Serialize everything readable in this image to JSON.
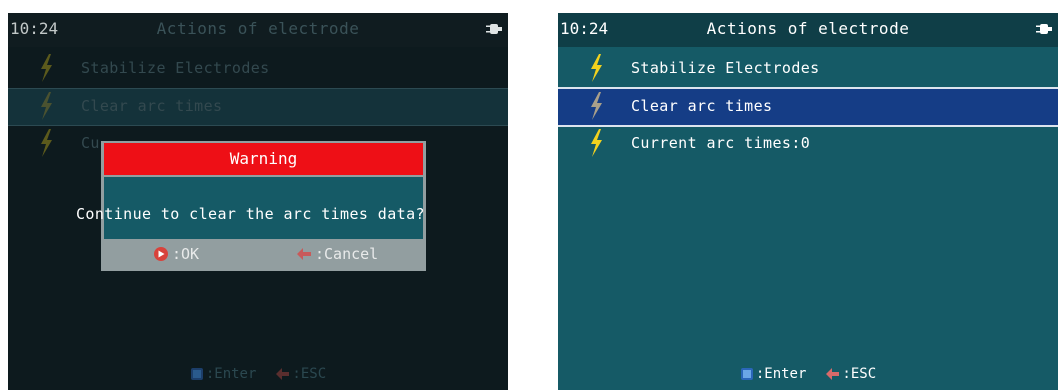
{
  "left": {
    "status": {
      "time": "10:24",
      "title": "Actions of electrode"
    },
    "menu": [
      {
        "label": "Stabilize Electrodes"
      },
      {
        "label": "Clear arc times",
        "selected": true
      },
      {
        "label": "Cu"
      }
    ],
    "dialog": {
      "title": "Warning",
      "message": "Continue to clear the arc times data?",
      "ok_label": ":OK",
      "cancel_label": ":Cancel"
    },
    "footer": {
      "enter": ":Enter",
      "esc": ":ESC"
    }
  },
  "right": {
    "status": {
      "time": "10:24",
      "title": "Actions of electrode"
    },
    "menu": [
      {
        "label": "Stabilize Electrodes"
      },
      {
        "label": "Clear arc times",
        "selected": true
      },
      {
        "label": "Current arc times:0"
      }
    ],
    "footer": {
      "enter": ":Enter",
      "esc": ":ESC"
    }
  },
  "colors": {
    "screen_bg": "#155a66",
    "selected_bg": "#153d86",
    "warning_red": "#ee0f16",
    "bolt_yellow": "#f2d21e"
  },
  "icons": {
    "status": "plug-icon",
    "menu": "lightning-bolt-icon",
    "enter": "enter-key-icon",
    "esc": "esc-key-icon",
    "ok": "ok-button-icon",
    "cancel": "back-arrow-icon"
  }
}
